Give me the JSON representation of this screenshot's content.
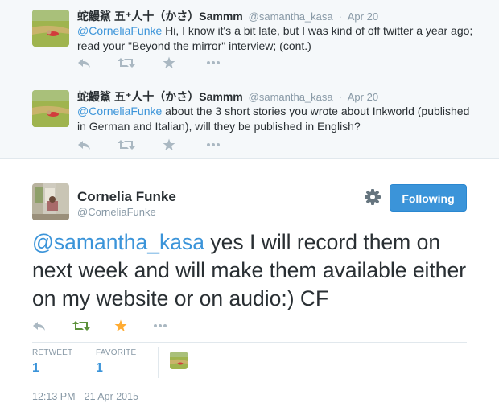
{
  "replies": [
    {
      "name": "蛇鰻鯊 五⁺人十（かさ）Sammm",
      "handle": "@samantha_kasa",
      "sep": "·",
      "date": "Apr 20",
      "mention": "@CorneliaFunke",
      "text": " Hi, I know it's a bit late, but I was kind of off twitter a year ago; read your \"Beyond the mirror\" interview; (cont.)"
    },
    {
      "name": "蛇鰻鯊 五⁺人十（かさ）Sammm",
      "handle": "@samantha_kasa",
      "sep": "·",
      "date": "Apr 20",
      "mention": "@CorneliaFunke",
      "text": " about the 3 short stories you wrote about Inkworld (published in German and Italian), will they be published in English?"
    }
  ],
  "main": {
    "name": "Cornelia Funke",
    "handle": "@CorneliaFunke",
    "follow_label": "Following",
    "mention": "@samantha_kasa",
    "text": " yes I will record them on next week and will make them available either on my website or on audio:) CF",
    "retweet_label": "RETWEET",
    "retweet_count": "1",
    "favorite_label": "FAVORITE",
    "favorite_count": "1",
    "timestamp": "12:13 PM - 21 Apr 2015"
  },
  "icons": {
    "reply": "reply-icon",
    "retweet": "retweet-icon",
    "favorite": "star-icon",
    "more": "more-icon",
    "settings": "gear-icon"
  },
  "colors": {
    "accent": "#3b94d9",
    "retweet_active": "#5c913b",
    "favorite_active": "#ffac33",
    "muted": "#aab8c2"
  }
}
